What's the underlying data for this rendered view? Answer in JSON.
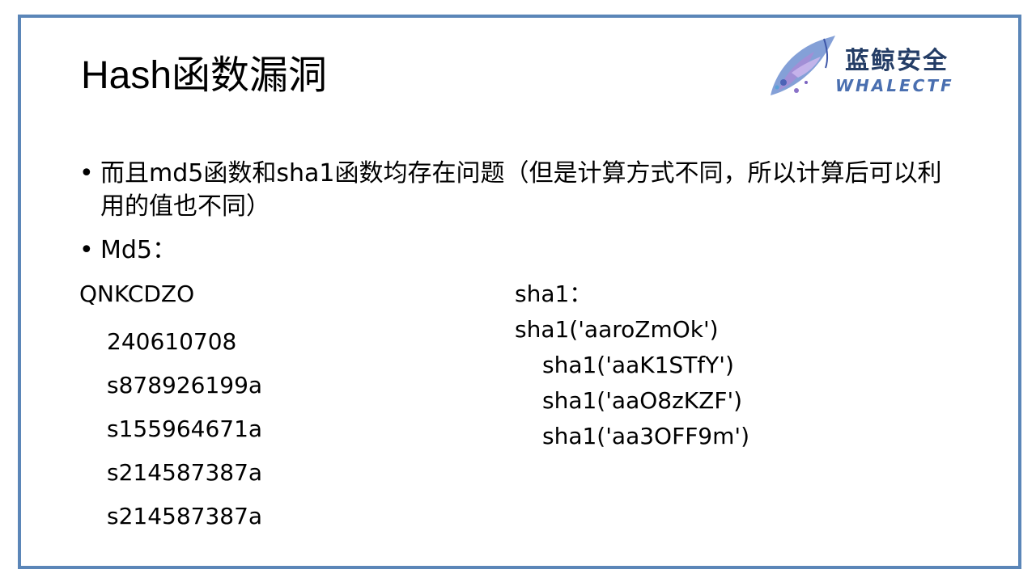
{
  "slide": {
    "title": "Hash函数漏洞",
    "logo": {
      "icon": "whale-icon",
      "name_cn": "蓝鲸安全",
      "name_en": "WHALECTF"
    },
    "bullets": [
      {
        "marker": "•",
        "text": "而且md5函数和sha1函数均存在问题（但是计算方式不同，所以计算后可以利用的值也不同）"
      },
      {
        "marker": "•",
        "text": "Md5："
      }
    ],
    "md5": {
      "heading": "QNKCDZO",
      "values": [
        "240610708",
        "s878926199a",
        "s155964671a",
        "s214587387a",
        "s214587387a"
      ]
    },
    "sha1": {
      "heading": "sha1：",
      "first": "sha1('aaroZmOk')",
      "values": [
        "sha1('aaK1STfY')",
        "sha1('aaO8zKZF')",
        "sha1('aa3OFF9m')"
      ]
    }
  }
}
